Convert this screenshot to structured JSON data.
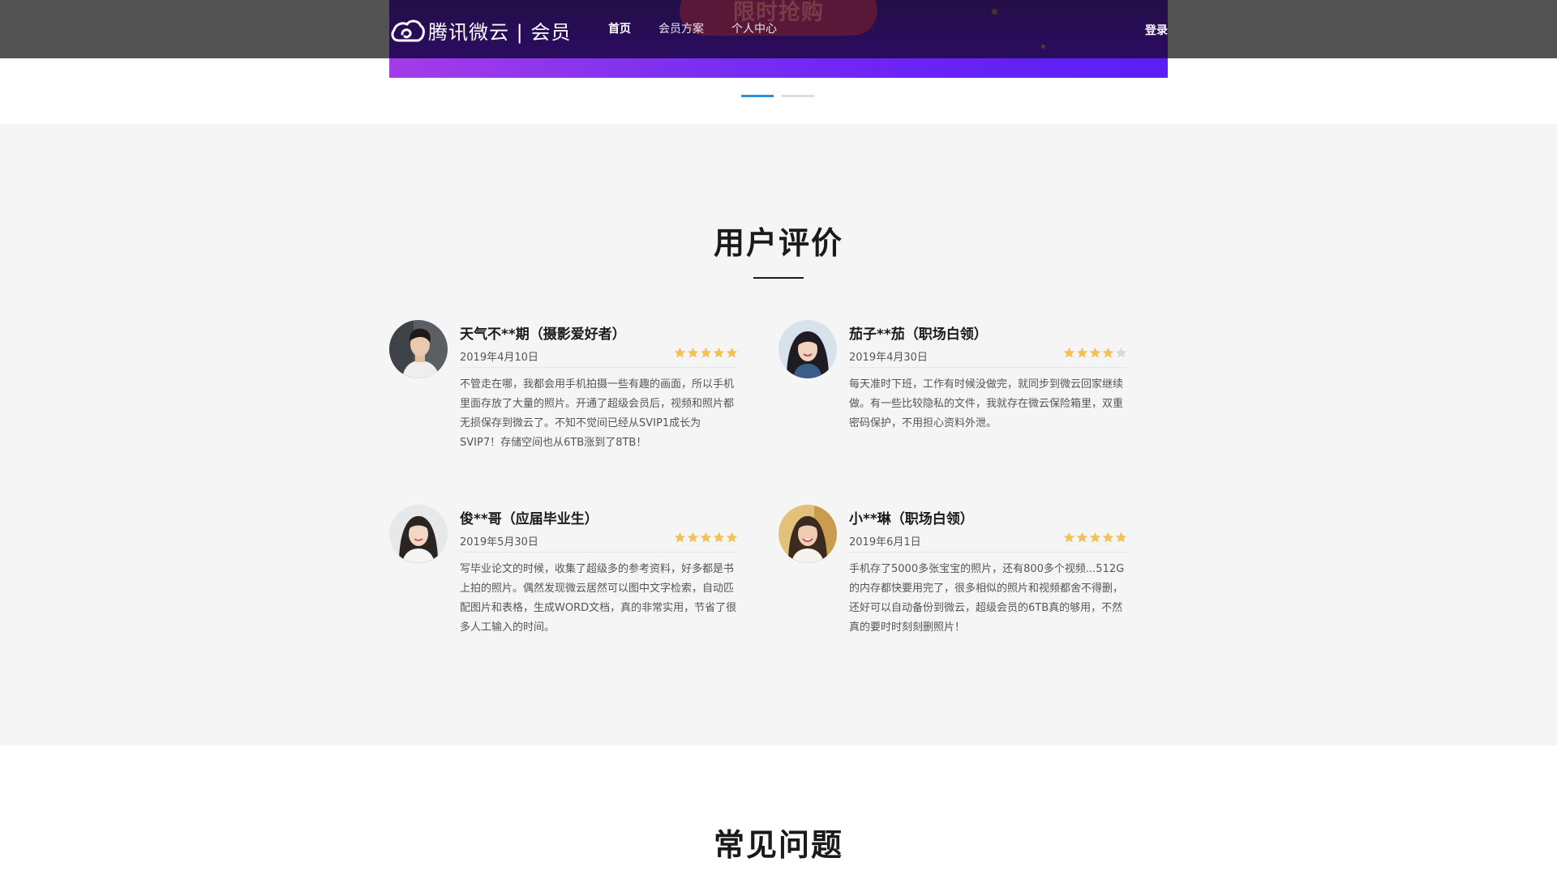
{
  "header": {
    "logo_text": "腾讯微云 | 会员",
    "promo_text": "限时抢购",
    "nav": [
      {
        "label": "首页",
        "active": true
      },
      {
        "label": "会员方案",
        "active": false
      },
      {
        "label": "个人中心",
        "active": false
      }
    ],
    "login_label": "登录"
  },
  "carousel": {
    "slide_count": 2,
    "active_index": 0
  },
  "reviews_section": {
    "title": "用户评价",
    "reviews": [
      {
        "name": "天气不**期（摄影爱好者）",
        "date": "2019年4月10日",
        "rating": 5,
        "text": "不管走在哪，我都会用手机拍摄一些有趣的画面，所以手机里面存放了大量的照片。开通了超级会员后，视频和照片都无损保存到微云了。不知不觉间已经从SVIP1成长为SVIP7！存储空间也从6TB涨到了8TB！"
      },
      {
        "name": "茄子**茄（职场白领）",
        "date": "2019年4月30日",
        "rating": 4,
        "text": "每天准时下班，工作有时候没做完，就同步到微云回家继续做。有一些比较隐私的文件，我就存在微云保险箱里，双重密码保护，不用担心资料外泄。"
      },
      {
        "name": "俊**哥（应届毕业生）",
        "date": "2019年5月30日",
        "rating": 5,
        "text": "写毕业论文的时候，收集了超级多的参考资料，好多都是书上拍的照片。偶然发现微云居然可以图中文字检索，自动匹配图片和表格，生成WORD文档，真的非常实用，节省了很多人工输入的时间。"
      },
      {
        "name": "小**琳（职场白领）",
        "date": "2019年6月1日",
        "rating": 5,
        "text": "手机存了5000多张宝宝的照片，还有800多个视频...512G的内存都快要用完了，很多相似的照片和视频都舍不得删，还好可以自动备份到微云，超级会员的6TB真的够用，不然真的要时时刻刻删照片！"
      }
    ]
  },
  "faq_section": {
    "title": "常见问题"
  },
  "colors": {
    "accent_blue": "#2c8fde",
    "star_gold": "#f5c151",
    "star_empty": "#d8d8d8"
  }
}
